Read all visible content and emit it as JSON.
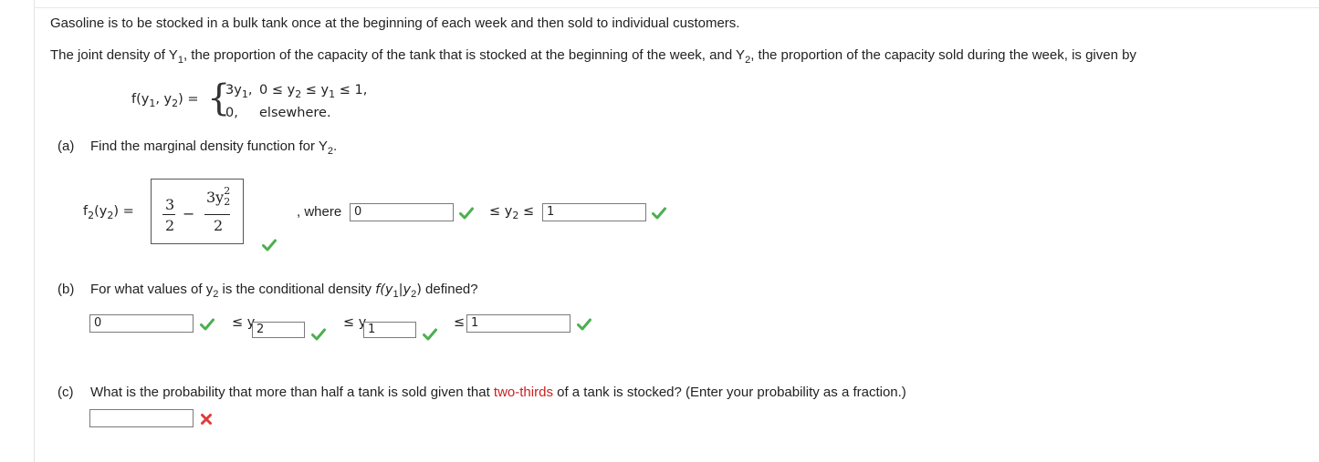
{
  "intro": {
    "line1": "Gasoline is to be stocked in a bulk tank once at the beginning of each week and then sold to individual customers.",
    "line2_a": "The joint density of Y",
    "line2_b": ", the proportion of the capacity of the tank that is stocked at the beginning of the week, and Y",
    "line2_c": ", the proportion of the capacity sold during the week, is given by"
  },
  "density": {
    "lhs": "f(y",
    "lhs2": ", y",
    "lhs3": ") =",
    "case1_expr": "3y",
    "case1_cond": "0 ≤ y",
    "case1_cond2": " ≤ y",
    "case1_cond3": " ≤ 1,",
    "case2_expr": "0,",
    "case2_cond": "elsewhere."
  },
  "part_a": {
    "label": "(a)",
    "question": "Find the marginal density function for Y",
    "lhs": "f",
    "lhs2": "(y",
    "lhs3": ") =",
    "answer_frac1_num": "3",
    "answer_frac1_den": "2",
    "answer_minus": "−",
    "answer_frac2_num": "3y",
    "answer_frac2_den": "2",
    "where": ", where",
    "lower_value": "0",
    "mid_text": "≤ y",
    "mid_text2": " ≤",
    "upper_value": "1"
  },
  "part_b": {
    "label": "(b)",
    "question_a": "For what values of y",
    "question_b": " is the conditional density ",
    "question_c": "f(y",
    "question_d": "|y",
    "question_e": ")",
    "question_f": " defined?",
    "box1_value": "0",
    "le1": "≤ y",
    "box2_value": "2",
    "le2": "≤ y",
    "box3_value": "1",
    "le3": "≤",
    "box4_value": "1"
  },
  "part_c": {
    "label": "(c)",
    "question_a": "What is the probability that more than half a tank is sold given that ",
    "highlight": "two-thirds",
    "question_b": " of a tank is stocked? (Enter your probability as a fraction.)",
    "answer_value": ""
  },
  "subscripts": {
    "one": "1",
    "two": "2"
  },
  "colors": {
    "check": "#4caf50",
    "cross": "#e03a3a",
    "highlight": "#cc1f1f"
  }
}
